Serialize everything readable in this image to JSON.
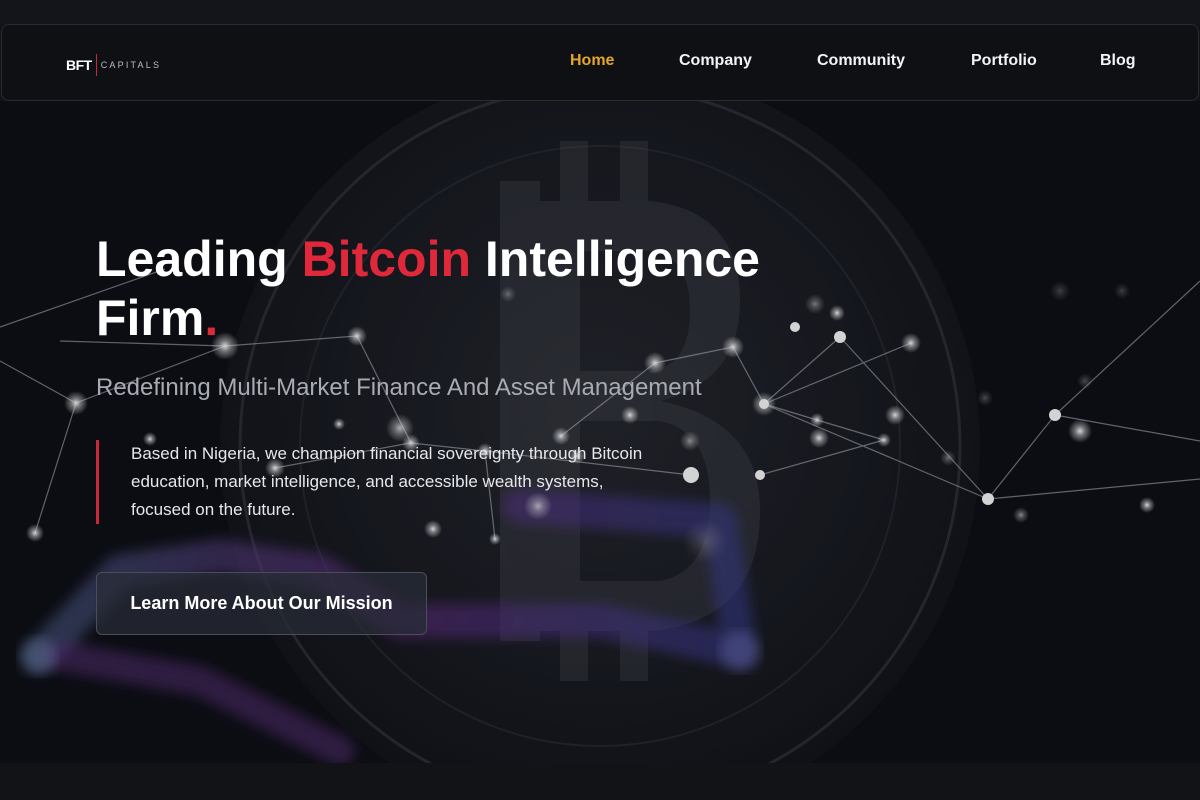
{
  "brand": {
    "logo_mark": "BFT",
    "logo_text": "CAPITALS",
    "accent": "#e4a52b",
    "red": "#e0283b"
  },
  "nav": {
    "items": [
      {
        "label": "Home",
        "active": true
      },
      {
        "label": "Company",
        "active": false
      },
      {
        "label": "Community",
        "active": false
      },
      {
        "label": "Portfolio",
        "active": false
      },
      {
        "label": "Blog",
        "active": false
      }
    ]
  },
  "hero": {
    "headline_part1": "Leading ",
    "headline_highlight": "Bitcoin",
    "headline_part2": " Intelligence Firm",
    "headline_dot": ".",
    "subheadline": "Redefining Multi-Market Finance And Asset Management",
    "description": "Based in Nigeria, we champion financial sovereignty through Bitcoin education, market intelligence, and accessible wealth systems, focused on the future.",
    "cta_label": "Learn More About Our Mission"
  }
}
